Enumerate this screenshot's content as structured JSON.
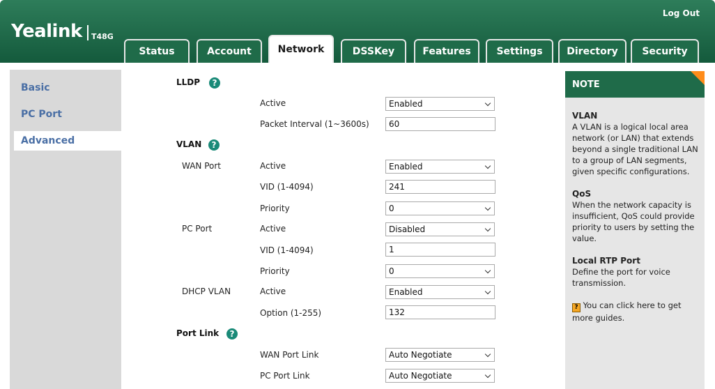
{
  "header": {
    "logo": "Yealink",
    "model": "T48G",
    "logout": "Log Out"
  },
  "tabs": [
    "Status",
    "Account",
    "Network",
    "DSSKey",
    "Features",
    "Settings",
    "Directory",
    "Security"
  ],
  "active_tab": "Network",
  "leftnav": [
    "Basic",
    "PC Port",
    "Advanced"
  ],
  "active_nav": "Advanced",
  "help_glyph": "?",
  "lldp": {
    "title": "LLDP",
    "active_label": "Active",
    "active_value": "Enabled",
    "interval_label": "Packet Interval (1~3600s)",
    "interval_value": "60"
  },
  "vlan": {
    "title": "VLAN",
    "wan": {
      "label": "WAN Port",
      "active_label": "Active",
      "active_value": "Enabled",
      "vid_label": "VID (1-4094)",
      "vid_value": "241",
      "priority_label": "Priority",
      "priority_value": "0"
    },
    "pc": {
      "label": "PC Port",
      "active_label": "Active",
      "active_value": "Disabled",
      "vid_label": "VID (1-4094)",
      "vid_value": "1",
      "priority_label": "Priority",
      "priority_value": "0"
    },
    "dhcp": {
      "label": "DHCP VLAN",
      "active_label": "Active",
      "active_value": "Enabled",
      "option_label": "Option (1-255)",
      "option_value": "132"
    }
  },
  "portlink": {
    "title": "Port Link",
    "wan_label": "WAN Port Link",
    "wan_value": "Auto Negotiate",
    "pc_label": "PC Port Link",
    "pc_value": "Auto Negotiate"
  },
  "note": {
    "title": "NOTE",
    "vlan_h": "VLAN",
    "vlan_p": "A VLAN is a logical local area network (or LAN) that extends beyond a single traditional LAN to a group of LAN segments, given specific configurations.",
    "qos_h": "QoS",
    "qos_p": "When the network capacity is insufficient, QoS could provide priority to users by setting the value.",
    "rtp_h": "Local RTP Port",
    "rtp_p": "Define the port for voice transmission.",
    "guide_icon_glyph": "?",
    "guide_text": "You can click here to get more guides."
  }
}
